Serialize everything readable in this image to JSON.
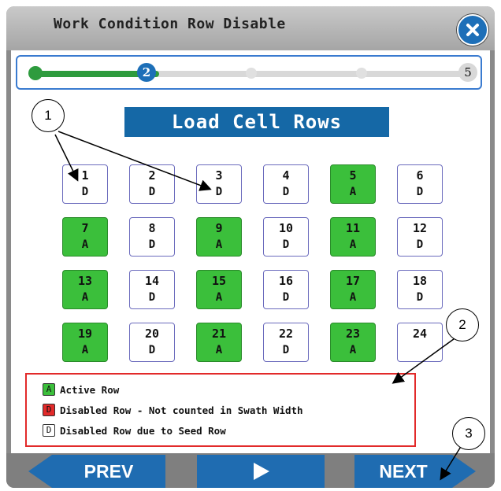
{
  "window": {
    "title": "Work Condition Row Disable",
    "close_label": "close"
  },
  "progress": {
    "current_step": "2",
    "last_step": "5",
    "fraction": 0.25
  },
  "section_title": "Load Cell Rows",
  "rows": [
    [
      {
        "n": "1",
        "s": "D",
        "a": false
      },
      {
        "n": "2",
        "s": "D",
        "a": false
      },
      {
        "n": "3",
        "s": "D",
        "a": false
      },
      {
        "n": "4",
        "s": "D",
        "a": false
      },
      {
        "n": "5",
        "s": "A",
        "a": true
      },
      {
        "n": "6",
        "s": "D",
        "a": false
      }
    ],
    [
      {
        "n": "7",
        "s": "A",
        "a": true
      },
      {
        "n": "8",
        "s": "D",
        "a": false
      },
      {
        "n": "9",
        "s": "A",
        "a": true
      },
      {
        "n": "10",
        "s": "D",
        "a": false
      },
      {
        "n": "11",
        "s": "A",
        "a": true
      },
      {
        "n": "12",
        "s": "D",
        "a": false
      }
    ],
    [
      {
        "n": "13",
        "s": "A",
        "a": true
      },
      {
        "n": "14",
        "s": "D",
        "a": false
      },
      {
        "n": "15",
        "s": "A",
        "a": true
      },
      {
        "n": "16",
        "s": "D",
        "a": false
      },
      {
        "n": "17",
        "s": "A",
        "a": true
      },
      {
        "n": "18",
        "s": "D",
        "a": false
      }
    ],
    [
      {
        "n": "19",
        "s": "A",
        "a": true
      },
      {
        "n": "20",
        "s": "D",
        "a": false
      },
      {
        "n": "21",
        "s": "A",
        "a": true
      },
      {
        "n": "22",
        "s": "D",
        "a": false
      },
      {
        "n": "23",
        "s": "A",
        "a": true
      },
      {
        "n": "24",
        "s": "",
        "a": false
      }
    ]
  ],
  "legend": {
    "active": {
      "key": "A",
      "text": "Active Row",
      "color": "#3bbf3b"
    },
    "disabled": {
      "key": "D",
      "text": "Disabled Row - Not counted in Swath Width",
      "color": "#e22a2a"
    },
    "seed": {
      "key": "D",
      "text": "Disabled Row due to Seed Row",
      "color": "#ffffff"
    }
  },
  "nav": {
    "prev_label": "PREV",
    "next_label": "NEXT",
    "play_icon": "play-icon"
  },
  "callouts": {
    "c1": "1",
    "c2": "2",
    "c3": "3"
  },
  "colors": {
    "accent": "#1f6cb1",
    "active": "#3bbf3b",
    "legend_border": "#e22a2a"
  }
}
